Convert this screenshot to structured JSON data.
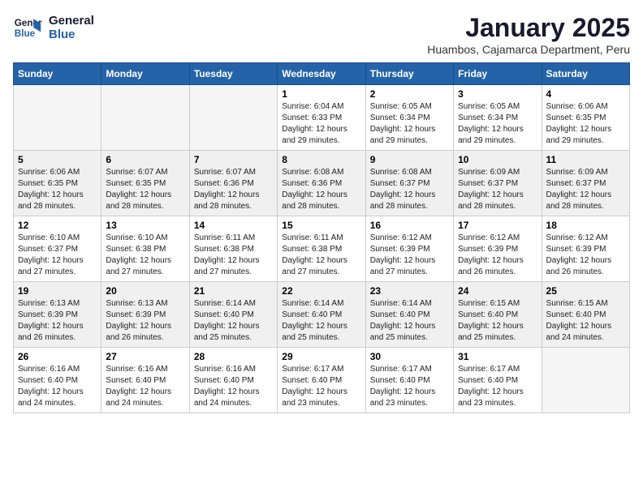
{
  "logo": {
    "line1": "General",
    "line2": "Blue"
  },
  "header": {
    "title": "January 2025",
    "subtitle": "Huambos, Cajamarca Department, Peru"
  },
  "weekdays": [
    "Sunday",
    "Monday",
    "Tuesday",
    "Wednesday",
    "Thursday",
    "Friday",
    "Saturday"
  ],
  "weeks": [
    [
      {
        "day": "",
        "info": ""
      },
      {
        "day": "",
        "info": ""
      },
      {
        "day": "",
        "info": ""
      },
      {
        "day": "1",
        "info": "Sunrise: 6:04 AM\nSunset: 6:33 PM\nDaylight: 12 hours\nand 29 minutes."
      },
      {
        "day": "2",
        "info": "Sunrise: 6:05 AM\nSunset: 6:34 PM\nDaylight: 12 hours\nand 29 minutes."
      },
      {
        "day": "3",
        "info": "Sunrise: 6:05 AM\nSunset: 6:34 PM\nDaylight: 12 hours\nand 29 minutes."
      },
      {
        "day": "4",
        "info": "Sunrise: 6:06 AM\nSunset: 6:35 PM\nDaylight: 12 hours\nand 29 minutes."
      }
    ],
    [
      {
        "day": "5",
        "info": "Sunrise: 6:06 AM\nSunset: 6:35 PM\nDaylight: 12 hours\nand 28 minutes."
      },
      {
        "day": "6",
        "info": "Sunrise: 6:07 AM\nSunset: 6:35 PM\nDaylight: 12 hours\nand 28 minutes."
      },
      {
        "day": "7",
        "info": "Sunrise: 6:07 AM\nSunset: 6:36 PM\nDaylight: 12 hours\nand 28 minutes."
      },
      {
        "day": "8",
        "info": "Sunrise: 6:08 AM\nSunset: 6:36 PM\nDaylight: 12 hours\nand 28 minutes."
      },
      {
        "day": "9",
        "info": "Sunrise: 6:08 AM\nSunset: 6:37 PM\nDaylight: 12 hours\nand 28 minutes."
      },
      {
        "day": "10",
        "info": "Sunrise: 6:09 AM\nSunset: 6:37 PM\nDaylight: 12 hours\nand 28 minutes."
      },
      {
        "day": "11",
        "info": "Sunrise: 6:09 AM\nSunset: 6:37 PM\nDaylight: 12 hours\nand 28 minutes."
      }
    ],
    [
      {
        "day": "12",
        "info": "Sunrise: 6:10 AM\nSunset: 6:37 PM\nDaylight: 12 hours\nand 27 minutes."
      },
      {
        "day": "13",
        "info": "Sunrise: 6:10 AM\nSunset: 6:38 PM\nDaylight: 12 hours\nand 27 minutes."
      },
      {
        "day": "14",
        "info": "Sunrise: 6:11 AM\nSunset: 6:38 PM\nDaylight: 12 hours\nand 27 minutes."
      },
      {
        "day": "15",
        "info": "Sunrise: 6:11 AM\nSunset: 6:38 PM\nDaylight: 12 hours\nand 27 minutes."
      },
      {
        "day": "16",
        "info": "Sunrise: 6:12 AM\nSunset: 6:39 PM\nDaylight: 12 hours\nand 27 minutes."
      },
      {
        "day": "17",
        "info": "Sunrise: 6:12 AM\nSunset: 6:39 PM\nDaylight: 12 hours\nand 26 minutes."
      },
      {
        "day": "18",
        "info": "Sunrise: 6:12 AM\nSunset: 6:39 PM\nDaylight: 12 hours\nand 26 minutes."
      }
    ],
    [
      {
        "day": "19",
        "info": "Sunrise: 6:13 AM\nSunset: 6:39 PM\nDaylight: 12 hours\nand 26 minutes."
      },
      {
        "day": "20",
        "info": "Sunrise: 6:13 AM\nSunset: 6:39 PM\nDaylight: 12 hours\nand 26 minutes."
      },
      {
        "day": "21",
        "info": "Sunrise: 6:14 AM\nSunset: 6:40 PM\nDaylight: 12 hours\nand 25 minutes."
      },
      {
        "day": "22",
        "info": "Sunrise: 6:14 AM\nSunset: 6:40 PM\nDaylight: 12 hours\nand 25 minutes."
      },
      {
        "day": "23",
        "info": "Sunrise: 6:14 AM\nSunset: 6:40 PM\nDaylight: 12 hours\nand 25 minutes."
      },
      {
        "day": "24",
        "info": "Sunrise: 6:15 AM\nSunset: 6:40 PM\nDaylight: 12 hours\nand 25 minutes."
      },
      {
        "day": "25",
        "info": "Sunrise: 6:15 AM\nSunset: 6:40 PM\nDaylight: 12 hours\nand 24 minutes."
      }
    ],
    [
      {
        "day": "26",
        "info": "Sunrise: 6:16 AM\nSunset: 6:40 PM\nDaylight: 12 hours\nand 24 minutes."
      },
      {
        "day": "27",
        "info": "Sunrise: 6:16 AM\nSunset: 6:40 PM\nDaylight: 12 hours\nand 24 minutes."
      },
      {
        "day": "28",
        "info": "Sunrise: 6:16 AM\nSunset: 6:40 PM\nDaylight: 12 hours\nand 24 minutes."
      },
      {
        "day": "29",
        "info": "Sunrise: 6:17 AM\nSunset: 6:40 PM\nDaylight: 12 hours\nand 23 minutes."
      },
      {
        "day": "30",
        "info": "Sunrise: 6:17 AM\nSunset: 6:40 PM\nDaylight: 12 hours\nand 23 minutes."
      },
      {
        "day": "31",
        "info": "Sunrise: 6:17 AM\nSunset: 6:40 PM\nDaylight: 12 hours\nand 23 minutes."
      },
      {
        "day": "",
        "info": ""
      }
    ]
  ]
}
